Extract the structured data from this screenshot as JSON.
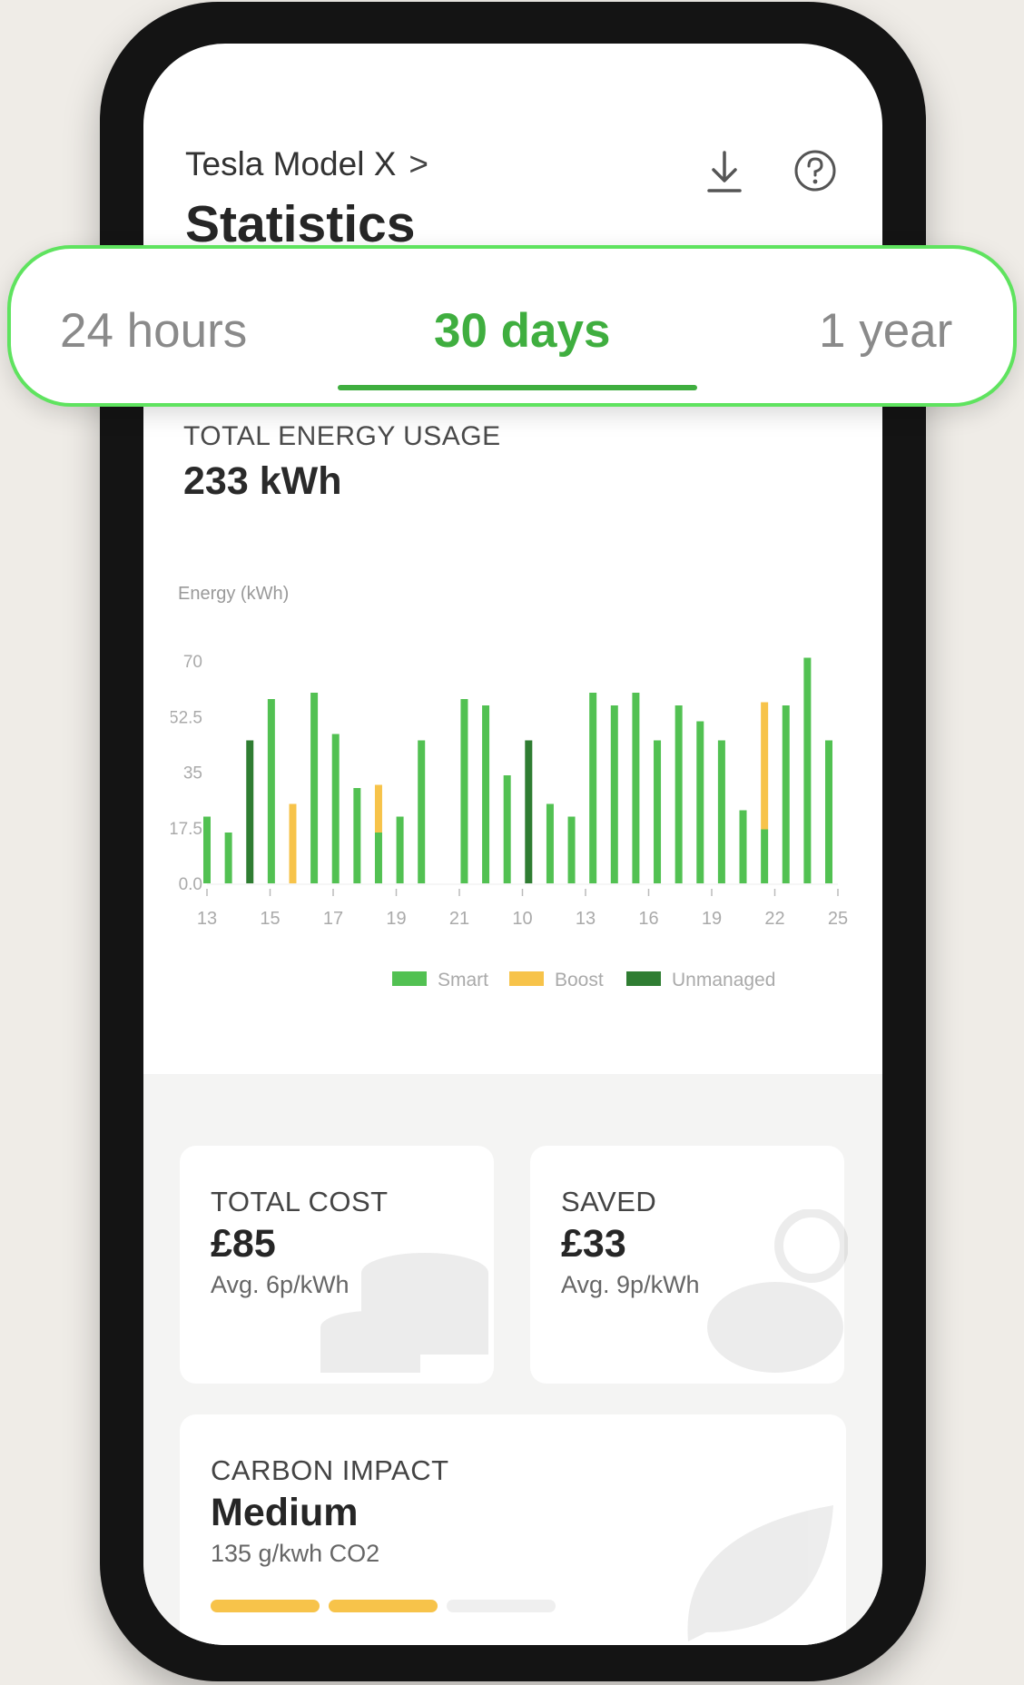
{
  "header": {
    "vehicle": "Tesla Model X",
    "vehicle_chevron": ">",
    "title": "Statistics",
    "download_icon": "download-icon",
    "help_icon": "help-icon"
  },
  "tabs": [
    {
      "label": "24 hours",
      "selected": false
    },
    {
      "label": "30 days",
      "selected": true
    },
    {
      "label": "1 year",
      "selected": false
    }
  ],
  "colors": {
    "accent": "#3fae3f",
    "smart": "#52c152",
    "boost": "#f7c34a",
    "unmanaged": "#2f7d32",
    "highlight_border": "#5fe35f"
  },
  "energy": {
    "label": "TOTAL ENERGY USAGE",
    "value": "233 kWh"
  },
  "chart_data": {
    "type": "bar",
    "stacked": true,
    "ylabel": "Energy (kWh)",
    "y_ticks": [
      "70",
      "52.5",
      "35",
      "17.5",
      "0.0"
    ],
    "ylim": [
      0,
      70
    ],
    "x_tick_labels": [
      "13",
      "15",
      "17",
      "19",
      "21",
      "10",
      "13",
      "16",
      "19",
      "22",
      "25"
    ],
    "grid": false,
    "legend": {
      "placement": "bottom-center",
      "entries": [
        "Smart",
        "Boost",
        "Unmanaged"
      ]
    },
    "bars": [
      {
        "smart": 21,
        "boost": 0,
        "unmanaged": 0
      },
      {
        "smart": 16,
        "boost": 0,
        "unmanaged": 0
      },
      {
        "smart": 0,
        "boost": 0,
        "unmanaged": 45
      },
      {
        "smart": 58,
        "boost": 0,
        "unmanaged": 0
      },
      {
        "smart": 0,
        "boost": 25,
        "unmanaged": 0
      },
      {
        "smart": 60,
        "boost": 0,
        "unmanaged": 0
      },
      {
        "smart": 47,
        "boost": 0,
        "unmanaged": 0
      },
      {
        "smart": 30,
        "boost": 0,
        "unmanaged": 0
      },
      {
        "smart": 16,
        "boost": 15,
        "unmanaged": 0
      },
      {
        "smart": 21,
        "boost": 0,
        "unmanaged": 0
      },
      {
        "smart": 45,
        "boost": 0,
        "unmanaged": 0
      },
      {
        "smart": 0,
        "boost": 0,
        "unmanaged": 0
      },
      {
        "smart": 58,
        "boost": 0,
        "unmanaged": 0
      },
      {
        "smart": 56,
        "boost": 0,
        "unmanaged": 0
      },
      {
        "smart": 34,
        "boost": 0,
        "unmanaged": 0
      },
      {
        "smart": 0,
        "boost": 0,
        "unmanaged": 45
      },
      {
        "smart": 25,
        "boost": 0,
        "unmanaged": 0
      },
      {
        "smart": 21,
        "boost": 0,
        "unmanaged": 0
      },
      {
        "smart": 60,
        "boost": 0,
        "unmanaged": 0
      },
      {
        "smart": 56,
        "boost": 0,
        "unmanaged": 0
      },
      {
        "smart": 60,
        "boost": 0,
        "unmanaged": 0
      },
      {
        "smart": 45,
        "boost": 0,
        "unmanaged": 0
      },
      {
        "smart": 56,
        "boost": 0,
        "unmanaged": 0
      },
      {
        "smart": 51,
        "boost": 0,
        "unmanaged": 0
      },
      {
        "smart": 45,
        "boost": 0,
        "unmanaged": 0
      },
      {
        "smart": 23,
        "boost": 0,
        "unmanaged": 0
      },
      {
        "smart": 17,
        "boost": 40,
        "unmanaged": 0
      },
      {
        "smart": 56,
        "boost": 0,
        "unmanaged": 0
      },
      {
        "smart": 71,
        "boost": 0,
        "unmanaged": 0
      },
      {
        "smart": 45,
        "boost": 0,
        "unmanaged": 0
      }
    ]
  },
  "cards": {
    "cost": {
      "label": "TOTAL COST",
      "value": "£85",
      "sub": "Avg. 6p/kWh",
      "icon": "coins-icon"
    },
    "saved": {
      "label": "SAVED",
      "value": "£33",
      "sub": "Avg. 9p/kWh",
      "icon": "piggy-bank-icon"
    },
    "carbon": {
      "label": "CARBON IMPACT",
      "value": "Medium",
      "sub": "135 g/kwh CO2",
      "icon": "leaf-icon",
      "level": 2,
      "max_level": 3
    }
  }
}
